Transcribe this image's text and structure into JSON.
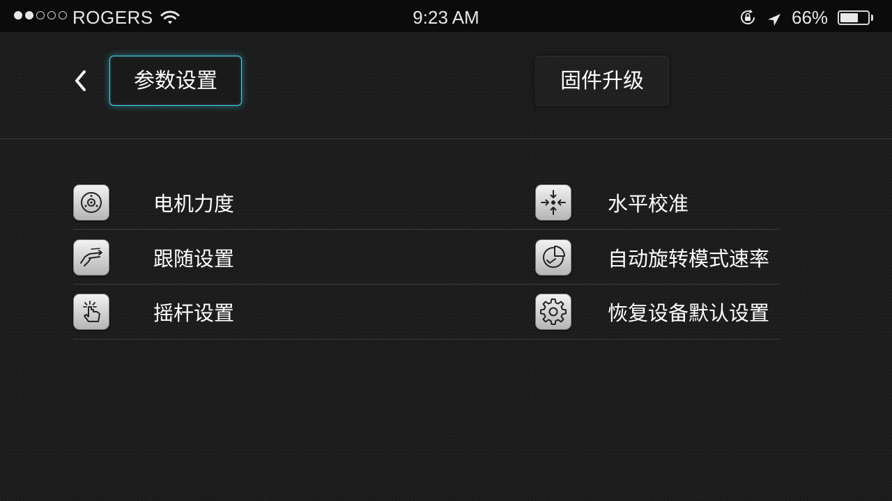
{
  "status_bar": {
    "carrier": "ROGERS",
    "signal_bars_filled": 2,
    "signal_bars_total": 5,
    "time": "9:23 AM",
    "battery_percent": "66%",
    "battery_level": 0.66
  },
  "header": {
    "back_icon": "chevron-left-icon",
    "tabs": [
      {
        "label": "参数设置",
        "active": true
      },
      {
        "label": "固件升级",
        "active": false
      }
    ]
  },
  "menu": {
    "left": [
      {
        "label": "电机力度",
        "icon": "motor-icon"
      },
      {
        "label": "跟随设置",
        "icon": "follow-hand-icon"
      },
      {
        "label": "摇杆设置",
        "icon": "touch-tap-icon"
      }
    ],
    "right": [
      {
        "label": "水平校准",
        "icon": "calibrate-icon"
      },
      {
        "label": "自动旋转模式速率",
        "icon": "rotate-speed-icon"
      },
      {
        "label": "恢复设备默认设置",
        "icon": "gear-icon"
      }
    ]
  },
  "colors": {
    "accent": "#4fd3ec",
    "background": "#1b1b1b",
    "status_bar_bg": "#0b0b0b"
  }
}
